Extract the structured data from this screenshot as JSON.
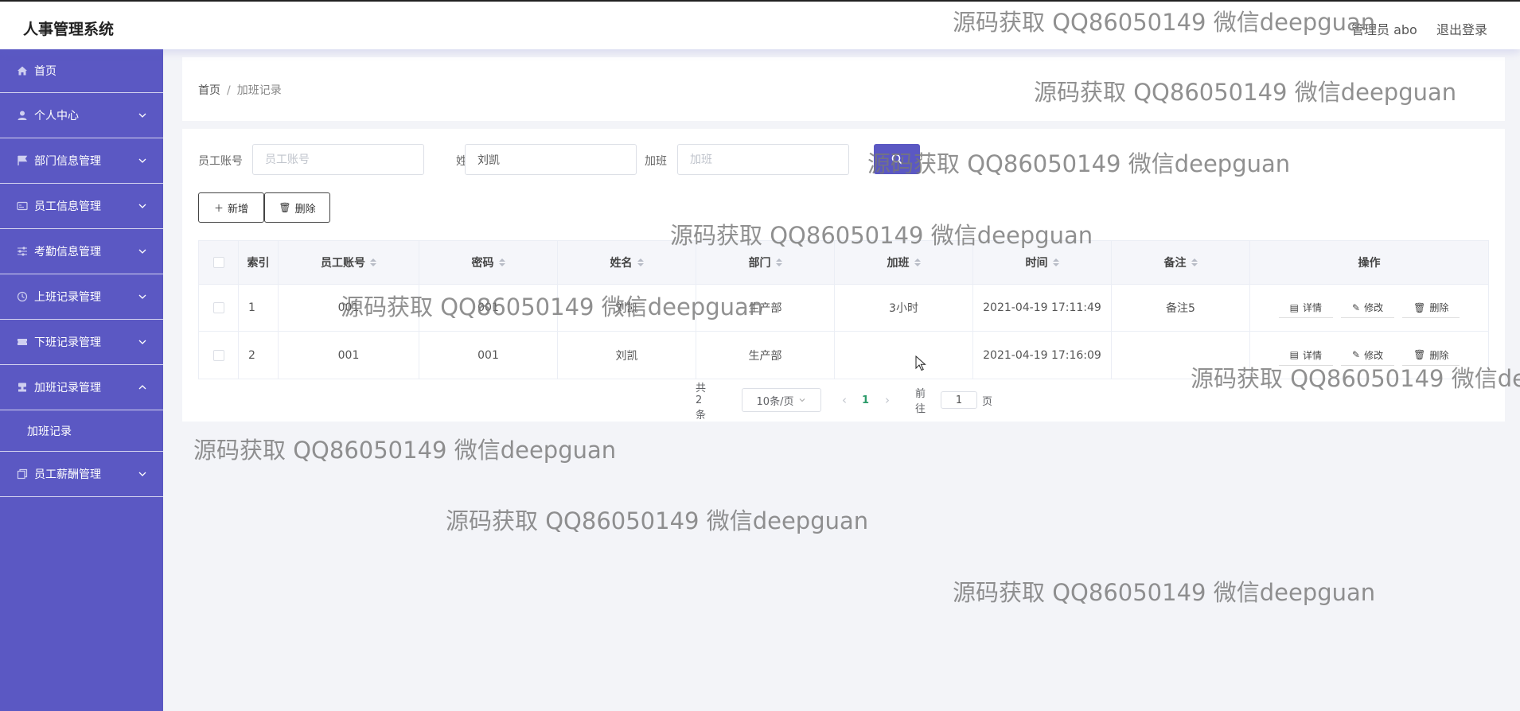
{
  "header": {
    "title": "人事管理系统",
    "admin": "管理员 abo",
    "logout": "退出登录"
  },
  "sidebar": {
    "items": [
      {
        "label": "首页",
        "icon": "home-icon"
      },
      {
        "label": "个人中心",
        "icon": "user-icon"
      },
      {
        "label": "部门信息管理",
        "icon": "flag-icon"
      },
      {
        "label": "员工信息管理",
        "icon": "card-icon"
      },
      {
        "label": "考勤信息管理",
        "icon": "sliders-icon"
      },
      {
        "label": "上班记录管理",
        "icon": "clock-icon"
      },
      {
        "label": "下班记录管理",
        "icon": "ticket-icon"
      },
      {
        "label": "加班记录管理",
        "icon": "stamp-icon",
        "expanded": true,
        "children": [
          "加班记录"
        ]
      },
      {
        "label": "员工薪酬管理",
        "icon": "copy-icon"
      }
    ]
  },
  "breadcrumb": {
    "home": "首页",
    "separator": "/",
    "current": "加班记录"
  },
  "search": {
    "account_label": "员工账号",
    "account_placeholder": "员工账号",
    "name_label": "姓名",
    "name_value": "刘凯",
    "overtime_label": "加班",
    "overtime_placeholder": "加班"
  },
  "actions": {
    "add": "新增",
    "delete": "删除"
  },
  "table": {
    "columns": [
      "索引",
      "员工账号",
      "密码",
      "姓名",
      "部门",
      "加班",
      "时间",
      "备注",
      "操作"
    ],
    "rows": [
      {
        "index": "1",
        "account": "001",
        "password": "001",
        "name": "刘凯",
        "dept": "生产部",
        "overtime": "3小时",
        "time": "2021-04-19 17:11:49",
        "note": "备注5"
      },
      {
        "index": "2",
        "account": "001",
        "password": "001",
        "name": "刘凯",
        "dept": "生产部",
        "overtime": "",
        "time": "2021-04-19 17:16:09",
        "note": ""
      }
    ],
    "row_ops": {
      "detail": "详情",
      "edit": "修改",
      "delete": "删除"
    }
  },
  "pagination": {
    "total": "共 2 条",
    "page_size": "10条/页",
    "current_page": "1",
    "goto_label": "前往",
    "goto_value": "1",
    "page_unit": "页"
  },
  "watermark": "源码获取 QQ86050149 微信deepguan",
  "colors": {
    "sidebar": "#5b58c3",
    "primary": "#5b58c3",
    "background": "#f3f4f8",
    "pager_active": "#2c9b6a"
  }
}
